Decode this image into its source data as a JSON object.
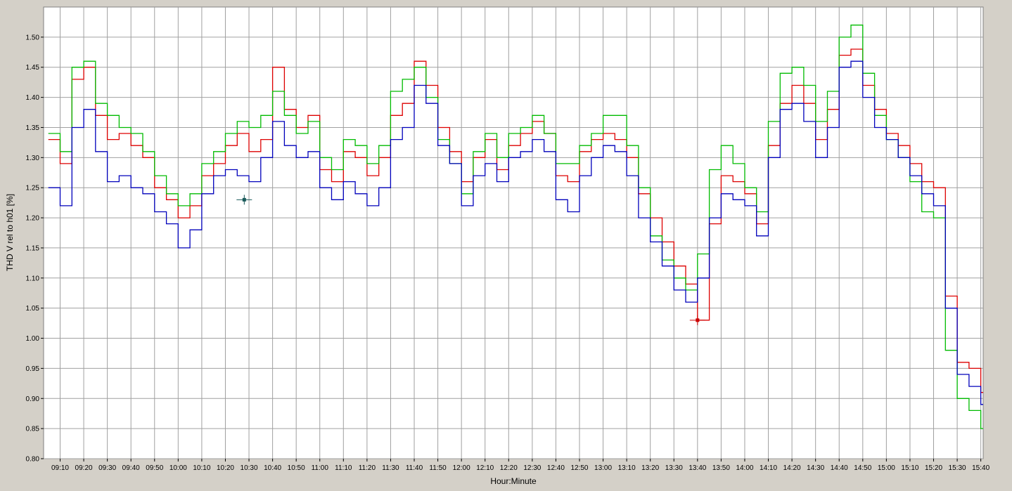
{
  "chart_data": {
    "type": "line",
    "title": "",
    "xlabel": "Hour:Minute",
    "ylabel": "THD V rel to h01 [%]",
    "ylim": [
      0.8,
      1.55
    ],
    "xlim": [
      "09:03",
      "15:41"
    ],
    "step": true,
    "grid": true,
    "legend": "none",
    "y_ticks": [
      "0.80",
      "0.85",
      "0.90",
      "0.95",
      "1.00",
      "1.05",
      "1.10",
      "1.15",
      "1.20",
      "1.25",
      "1.30",
      "1.35",
      "1.40",
      "1.45",
      "1.50"
    ],
    "x_ticks": [
      "09:10",
      "09:20",
      "09:30",
      "09:40",
      "09:50",
      "10:00",
      "10:10",
      "10:20",
      "10:30",
      "10:40",
      "10:50",
      "11:00",
      "11:10",
      "11:20",
      "11:30",
      "11:40",
      "11:50",
      "12:00",
      "12:10",
      "12:20",
      "12:30",
      "12:40",
      "12:50",
      "13:00",
      "13:10",
      "13:20",
      "13:30",
      "13:40",
      "13:50",
      "14:00",
      "14:10",
      "14:20",
      "14:30",
      "14:40",
      "14:50",
      "15:00",
      "15:10",
      "15:20",
      "15:30",
      "15:40"
    ],
    "x": [
      "09:05",
      "09:10",
      "09:15",
      "09:20",
      "09:25",
      "09:30",
      "09:35",
      "09:40",
      "09:45",
      "09:50",
      "09:55",
      "10:00",
      "10:05",
      "10:10",
      "10:15",
      "10:20",
      "10:25",
      "10:30",
      "10:35",
      "10:40",
      "10:45",
      "10:50",
      "10:55",
      "11:00",
      "11:05",
      "11:10",
      "11:15",
      "11:20",
      "11:25",
      "11:30",
      "11:35",
      "11:40",
      "11:45",
      "11:50",
      "11:55",
      "12:00",
      "12:05",
      "12:10",
      "12:15",
      "12:20",
      "12:25",
      "12:30",
      "12:35",
      "12:40",
      "12:45",
      "12:50",
      "12:55",
      "13:00",
      "13:05",
      "13:10",
      "13:15",
      "13:20",
      "13:25",
      "13:30",
      "13:35",
      "13:40",
      "13:45",
      "13:50",
      "13:55",
      "14:00",
      "14:05",
      "14:10",
      "14:15",
      "14:20",
      "14:25",
      "14:30",
      "14:35",
      "14:40",
      "14:45",
      "14:50",
      "14:55",
      "15:00",
      "15:05",
      "15:10",
      "15:15",
      "15:20",
      "15:25",
      "15:30",
      "15:35",
      "15:40"
    ],
    "series": [
      {
        "color": "#dd0000",
        "values": [
          1.33,
          1.29,
          1.43,
          1.45,
          1.37,
          1.33,
          1.34,
          1.32,
          1.3,
          1.25,
          1.23,
          1.2,
          1.22,
          1.27,
          1.29,
          1.32,
          1.34,
          1.31,
          1.33,
          1.45,
          1.38,
          1.35,
          1.37,
          1.28,
          1.26,
          1.31,
          1.3,
          1.27,
          1.3,
          1.37,
          1.39,
          1.46,
          1.42,
          1.35,
          1.31,
          1.26,
          1.3,
          1.33,
          1.28,
          1.32,
          1.34,
          1.36,
          1.34,
          1.27,
          1.26,
          1.31,
          1.33,
          1.34,
          1.33,
          1.3,
          1.24,
          1.2,
          1.16,
          1.12,
          1.09,
          1.03,
          1.19,
          1.27,
          1.26,
          1.24,
          1.19,
          1.32,
          1.39,
          1.42,
          1.39,
          1.33,
          1.38,
          1.47,
          1.48,
          1.42,
          1.38,
          1.34,
          1.32,
          1.29,
          1.26,
          1.25,
          1.07,
          0.96,
          0.95,
          0.91
        ]
      },
      {
        "color": "#00bb00",
        "values": [
          1.34,
          1.31,
          1.45,
          1.46,
          1.39,
          1.37,
          1.35,
          1.34,
          1.31,
          1.27,
          1.24,
          1.22,
          1.24,
          1.29,
          1.31,
          1.34,
          1.36,
          1.35,
          1.37,
          1.41,
          1.37,
          1.34,
          1.36,
          1.3,
          1.28,
          1.33,
          1.32,
          1.29,
          1.32,
          1.41,
          1.43,
          1.45,
          1.4,
          1.33,
          1.29,
          1.24,
          1.31,
          1.34,
          1.3,
          1.34,
          1.35,
          1.37,
          1.34,
          1.29,
          1.29,
          1.32,
          1.34,
          1.37,
          1.37,
          1.32,
          1.25,
          1.17,
          1.13,
          1.1,
          1.08,
          1.14,
          1.28,
          1.32,
          1.29,
          1.25,
          1.21,
          1.36,
          1.44,
          1.45,
          1.42,
          1.36,
          1.41,
          1.5,
          1.52,
          1.44,
          1.37,
          1.33,
          1.3,
          1.26,
          1.21,
          1.2,
          0.98,
          0.9,
          0.88,
          0.85
        ]
      },
      {
        "color": "#0000bb",
        "values": [
          1.25,
          1.22,
          1.35,
          1.38,
          1.31,
          1.26,
          1.27,
          1.25,
          1.24,
          1.21,
          1.19,
          1.15,
          1.18,
          1.24,
          1.27,
          1.28,
          1.27,
          1.26,
          1.3,
          1.36,
          1.32,
          1.3,
          1.31,
          1.25,
          1.23,
          1.26,
          1.24,
          1.22,
          1.25,
          1.33,
          1.35,
          1.42,
          1.39,
          1.32,
          1.29,
          1.22,
          1.27,
          1.29,
          1.26,
          1.3,
          1.31,
          1.33,
          1.31,
          1.23,
          1.21,
          1.27,
          1.3,
          1.32,
          1.31,
          1.27,
          1.2,
          1.16,
          1.12,
          1.08,
          1.06,
          1.1,
          1.2,
          1.24,
          1.23,
          1.22,
          1.17,
          1.3,
          1.38,
          1.39,
          1.36,
          1.3,
          1.35,
          1.45,
          1.46,
          1.4,
          1.35,
          1.33,
          1.3,
          1.27,
          1.24,
          1.22,
          1.05,
          0.94,
          0.92,
          0.89
        ]
      }
    ],
    "markers": [
      {
        "x": "10:28",
        "y": 1.23,
        "color": "#1a5a5a"
      },
      {
        "x": "13:40",
        "y": 1.03,
        "color": "#cc0000"
      }
    ]
  }
}
